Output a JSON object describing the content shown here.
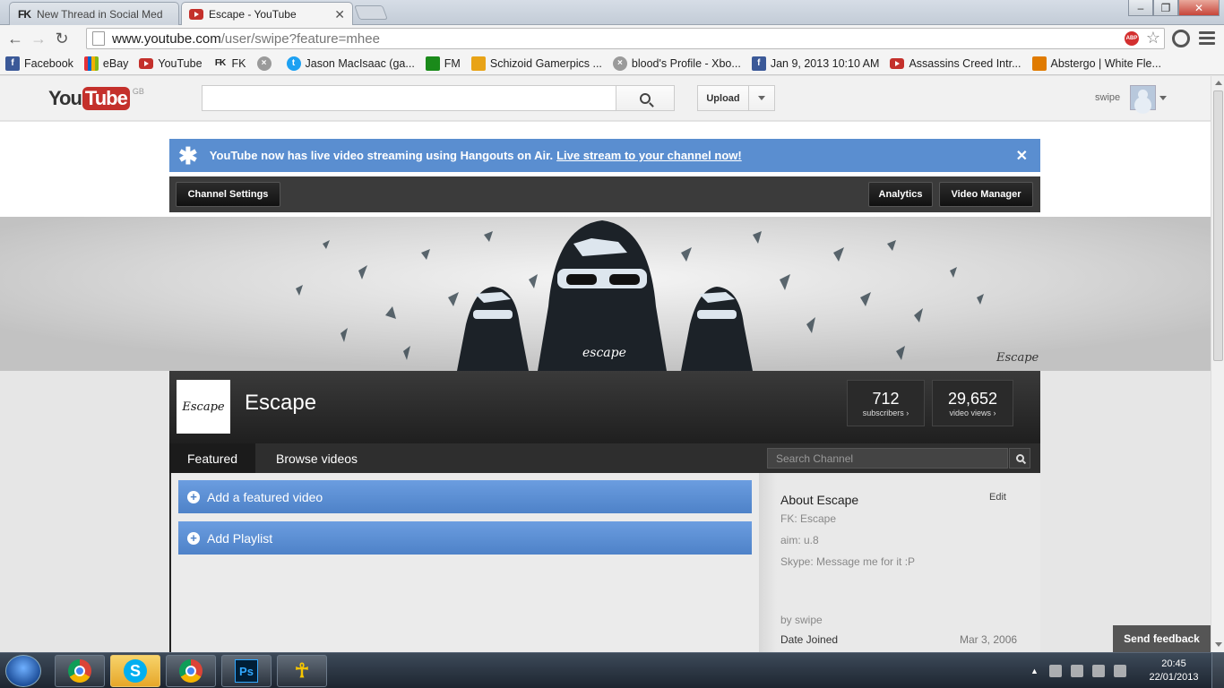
{
  "browser": {
    "tabs": [
      {
        "title": "New Thread in Social Med",
        "icon": "fk-icon",
        "active": false
      },
      {
        "title": "Escape - YouTube",
        "icon": "youtube-icon",
        "active": true
      }
    ],
    "url_host": "www.youtube.com",
    "url_path": "/user/swipe?feature=mhee",
    "abp_label": "ABP",
    "bookmarks": [
      {
        "label": "Facebook",
        "icon": "facebook-icon"
      },
      {
        "label": "eBay",
        "icon": "ebay-icon"
      },
      {
        "label": "YouTube",
        "icon": "youtube-icon"
      },
      {
        "label": "FK",
        "icon": "fk-icon"
      },
      {
        "label": "",
        "icon": "xbox-icon"
      },
      {
        "label": "Jason MacIsaac (ga...",
        "icon": "twitter-icon"
      },
      {
        "label": "FM",
        "icon": "fm-icon"
      },
      {
        "label": "Schizoid Gamerpics ...",
        "icon": "gamerpics-icon"
      },
      {
        "label": "blood's Profile - Xbo...",
        "icon": "xbox-icon"
      },
      {
        "label": "Jan 9, 2013 10:10 AM",
        "icon": "facebook-icon"
      },
      {
        "label": "Assassins Creed Intr...",
        "icon": "youtube-icon"
      },
      {
        "label": "Abstergo | White Fle...",
        "icon": "abstergo-icon"
      }
    ]
  },
  "masthead": {
    "logo_you": "You",
    "logo_tube": "Tube",
    "logo_region": "GB",
    "upload_label": "Upload",
    "user_name": "swipe"
  },
  "notice": {
    "text": "YouTube now has live video streaming using Hangouts on Air.",
    "link": "Live stream to your channel now!"
  },
  "owner_bar": {
    "channel_settings": "Channel Settings",
    "analytics": "Analytics",
    "video_manager": "Video Manager"
  },
  "banner": {
    "text": "escape",
    "signature": "Escape"
  },
  "channel": {
    "avatar_text": "Escape",
    "name": "Escape",
    "subscribers": "712",
    "subscribers_label": "subscribers ›",
    "views": "29,652",
    "views_label": "video views ›",
    "tabs": [
      "Featured",
      "Browse videos"
    ],
    "search_placeholder": "Search Channel",
    "actions": [
      "Add a featured video",
      "Add Playlist"
    ]
  },
  "about": {
    "title": "About Escape",
    "edit": "Edit",
    "lines": [
      "FK: Escape",
      "aim: u.8",
      "Skype: Message me for it :P"
    ],
    "by": "by swipe",
    "date_label": "Date Joined",
    "date_value": "Mar 3, 2006"
  },
  "feedback": "Send feedback",
  "taskbar": {
    "apps": [
      "chrome-icon",
      "skype-icon",
      "chrome-icon",
      "photoshop-icon",
      "aim-icon"
    ],
    "time": "20:45",
    "date": "22/01/2013"
  }
}
